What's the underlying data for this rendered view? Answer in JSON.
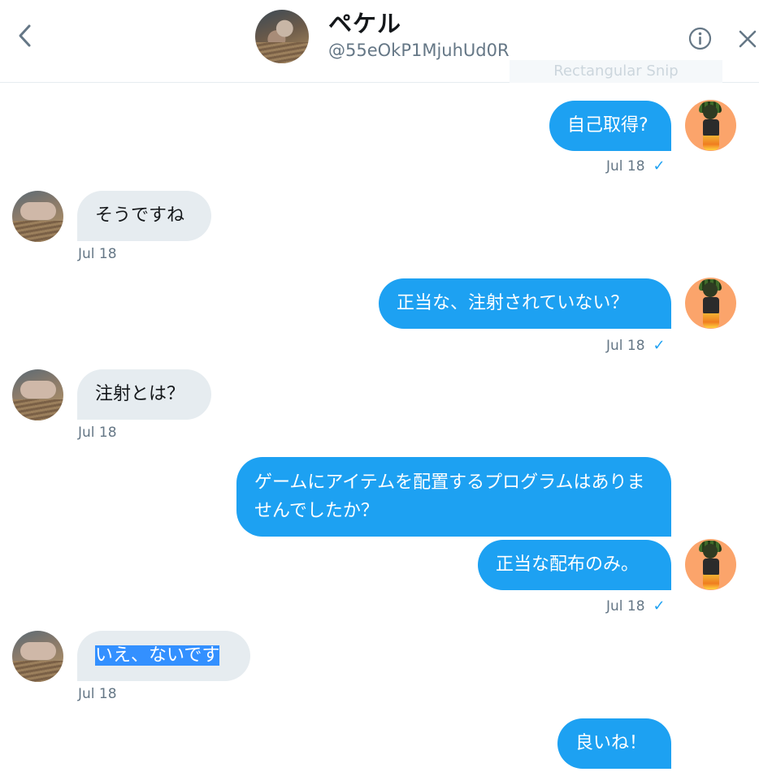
{
  "header": {
    "name": "ペケル",
    "handle": "@55eOkP1MjuhUd0R",
    "overlay_label": "Rectangular Snip"
  },
  "icons": {
    "back": "chevron-left-icon",
    "info": "info-icon",
    "close": "close-icon"
  },
  "colors": {
    "accent": "#1da1f2",
    "incoming_bubble": "#e6ecf0",
    "meta_text": "#657786",
    "selection": "#3390ff"
  },
  "messages": [
    {
      "dir": "out",
      "text": "自己取得?",
      "time": "Jul 18",
      "read": "✓"
    },
    {
      "dir": "in",
      "text": "そうですね",
      "time": "Jul 18"
    },
    {
      "dir": "out",
      "text": "正当な、注射されていない？",
      "time": "Jul 18",
      "read": "✓"
    },
    {
      "dir": "in",
      "text": "注射とは？",
      "time": "Jul 18"
    },
    {
      "dir": "out",
      "text": "ゲームにアイテムを配置するプログラムはありませんでしたか？"
    },
    {
      "dir": "out",
      "text": "正当な配布のみ。",
      "time": "Jul 18",
      "read": "✓"
    },
    {
      "dir": "in",
      "text": "いえ、ないです",
      "time": "Jul 18",
      "selected": true
    },
    {
      "dir": "out",
      "text": "良いね！"
    }
  ]
}
